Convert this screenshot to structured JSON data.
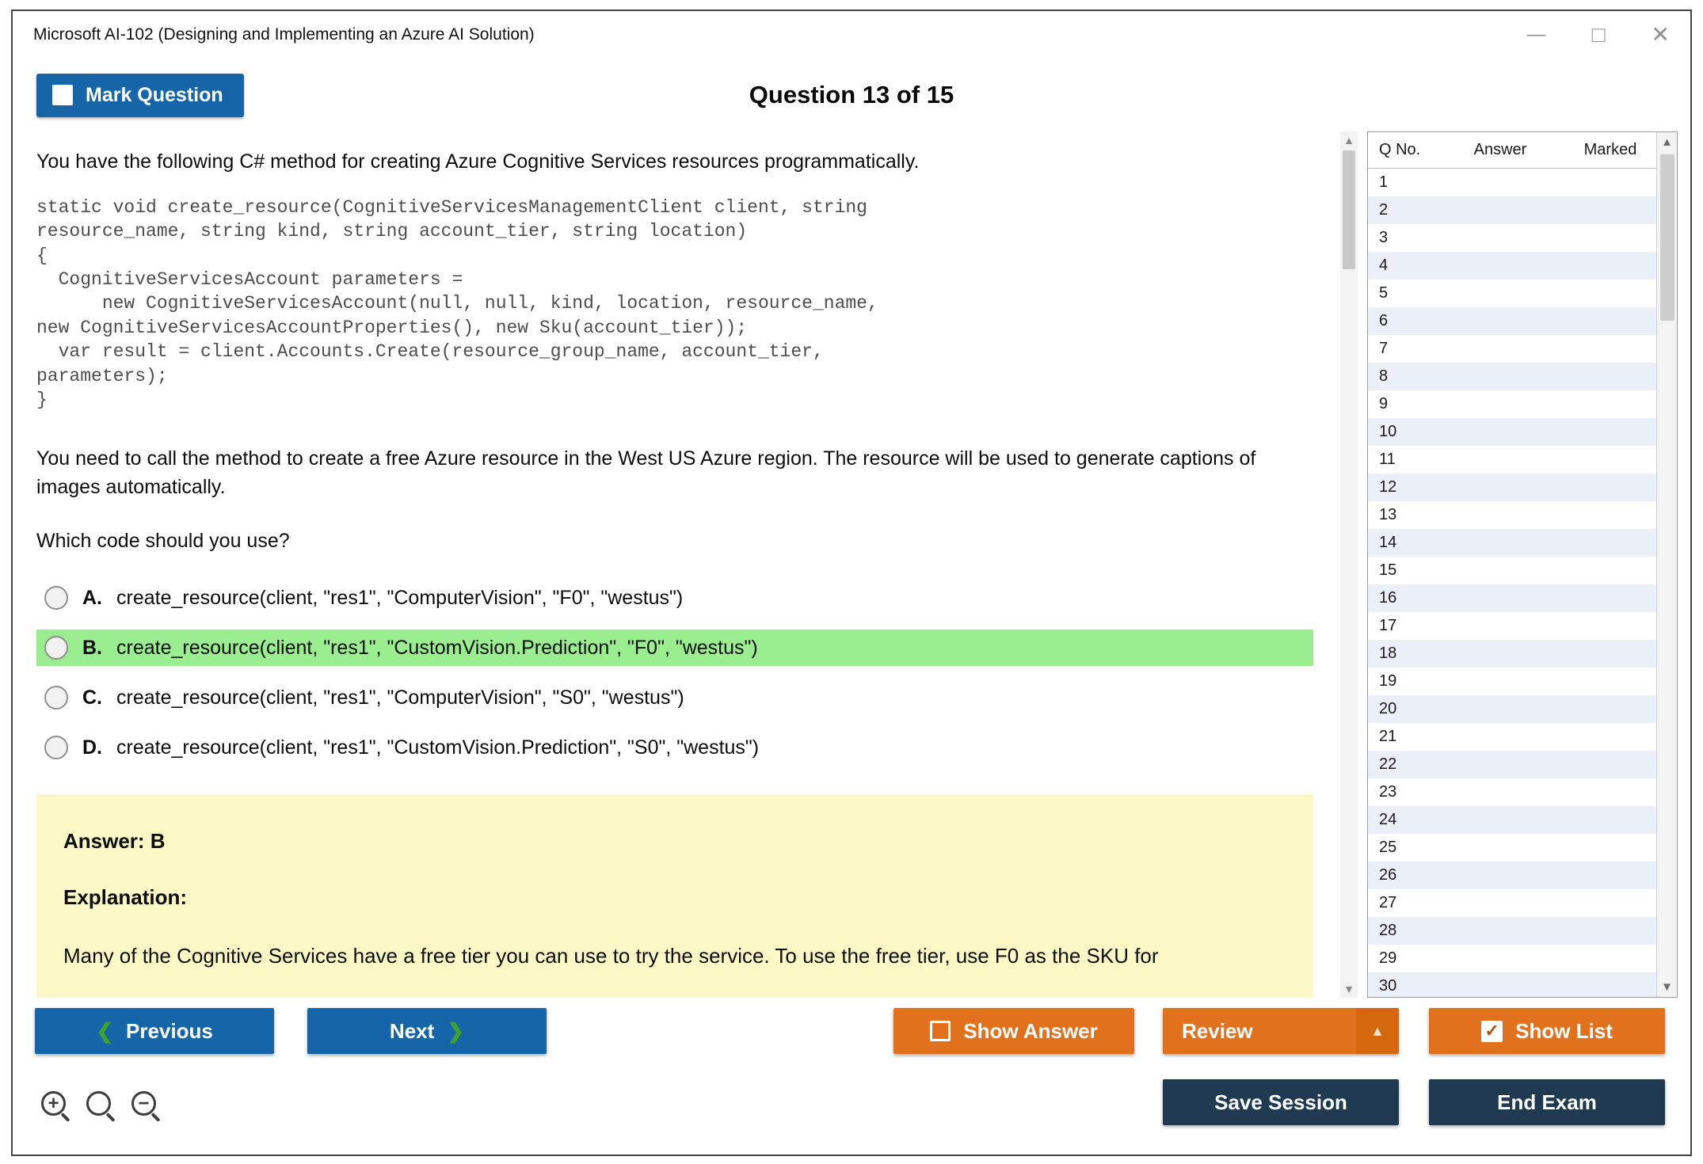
{
  "window": {
    "title": "Microsoft AI-102 (Designing and Implementing an Azure AI Solution)"
  },
  "icons": {
    "minimize": "—",
    "maximize": "□",
    "close": "✕",
    "chevron_left": "❮",
    "chevron_right": "❯",
    "scroll_up": "▲",
    "scroll_down": "▼",
    "check": "✓",
    "caret_up": "▲",
    "zoom_in_sign": "+",
    "zoom_out_sign": "−"
  },
  "header": {
    "mark_question_label": "Mark Question",
    "question_counter": "Question 13 of 15"
  },
  "question": {
    "intro": "You have the following C# method for creating Azure Cognitive Services resources programmatically.",
    "code": "static void create_resource(CognitiveServicesManagementClient client, string\nresource_name, string kind, string account_tier, string location)\n{\n  CognitiveServicesAccount parameters =\n      new CognitiveServicesAccount(null, null, kind, location, resource_name,\nnew CognitiveServicesAccountProperties(), new Sku(account_tier));\n  var result = client.Accounts.Create(resource_group_name, account_tier,\nparameters);\n}",
    "scenario": "You need to call the method to create a free Azure resource in the West US Azure region. The resource will be used to generate captions of images automatically.",
    "prompt": "Which code should you use?",
    "options": [
      {
        "letter": "A.",
        "text": "create_resource(client, \"res1\", \"ComputerVision\", \"F0\", \"westus\")",
        "highlighted": false
      },
      {
        "letter": "B.",
        "text": "create_resource(client, \"res1\", \"CustomVision.Prediction\", \"F0\", \"westus\")",
        "highlighted": true
      },
      {
        "letter": "C.",
        "text": "create_resource(client, \"res1\", \"ComputerVision\", \"S0\", \"westus\")",
        "highlighted": false
      },
      {
        "letter": "D.",
        "text": "create_resource(client, \"res1\", \"CustomVision.Prediction\", \"S0\", \"westus\")",
        "highlighted": false
      }
    ],
    "answer_label": "Answer: B",
    "explanation_label": "Explanation:",
    "explanation_text": "Many of the Cognitive Services have a free tier you can use to try the service. To use the free tier, use F0 as the SKU for"
  },
  "question_list": {
    "columns": {
      "qno": "Q No.",
      "answer": "Answer",
      "marked": "Marked"
    },
    "rows": [
      "1",
      "2",
      "3",
      "4",
      "5",
      "6",
      "7",
      "8",
      "9",
      "10",
      "11",
      "12",
      "13",
      "14",
      "15",
      "16",
      "17",
      "18",
      "19",
      "20",
      "21",
      "22",
      "23",
      "24",
      "25",
      "26",
      "27",
      "28",
      "29",
      "30"
    ]
  },
  "footer": {
    "previous": "Previous",
    "next": "Next",
    "show_answer": "Show Answer",
    "review": "Review",
    "show_list": "Show List",
    "save_session": "Save Session",
    "end_exam": "End Exam"
  },
  "colors": {
    "accent_blue": "#1565a8",
    "accent_orange": "#e2711d",
    "navy": "#203a52",
    "highlight_green": "#9bee90",
    "explanation_yellow": "#fcf8c6",
    "chevron_green": "#3fa32a"
  }
}
